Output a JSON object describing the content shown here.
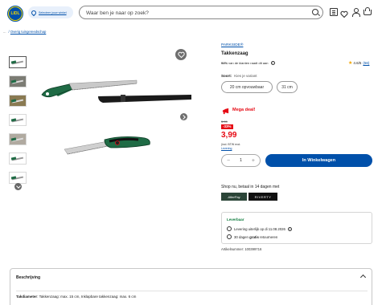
{
  "header": {
    "logo_text": "LIDL",
    "store_selector": "Selecteer jouw winkel",
    "search_placeholder": "Waar ben je naar op zoek?",
    "icons": [
      "receipt-icon",
      "heart-icon",
      "user-icon",
      "cart-icon"
    ]
  },
  "breadcrumb": {
    "dots": "...",
    "link": "Overig tuingereedschap"
  },
  "gallery": {
    "thumbnail_count": 7,
    "icons": [
      "heart-icon",
      "chevron-right-icon",
      "chevron-down-icon"
    ]
  },
  "product": {
    "brand": "PARKSIDE®",
    "title": "Takkenzaag",
    "recommend_pct": "94%",
    "recommend_text": "van de klanten raadt dit aan",
    "rating": "4.6/5",
    "review_count": "(56)"
  },
  "variant": {
    "label": "Soort:",
    "hint": "Kies je variant",
    "options": [
      "20 cm opvouwbaar",
      "31 cm"
    ]
  },
  "price": {
    "deal_label": "Mega deal!",
    "old_price": "5.99",
    "discount": "-33%",
    "current": "3,99",
    "vat_note": "(incl. BTW excl.",
    "shipping_link": "Levering"
  },
  "cart": {
    "quantity": "1",
    "minus": "−",
    "plus": "+",
    "button": "In Winkelwagen"
  },
  "payment": {
    "text": "Shop nu, betaal in 14 dagen met",
    "provider1": "AfterPay",
    "provider2": "RIVERTY"
  },
  "delivery": {
    "status": "Leverbaar",
    "row1": "Levering uiterlijk op di 11.08.2026",
    "row2_prefix": "30 dagen",
    "row2_bold": "gratis",
    "row2_suffix": "retourneren"
  },
  "article_number": "Artikelnummer: 100399716",
  "description": {
    "heading": "Beschrijving",
    "line_label": "Takdiameter",
    "line_value": ": Takkenzaag: max. 15 cm, Inklapbare takkenzaag: max. 6 cm"
  },
  "colors": {
    "brand_blue": "#0050aa",
    "deal_red": "#e60a14",
    "available_green": "#0b7a3b",
    "handle_green": "#1f6b45"
  }
}
